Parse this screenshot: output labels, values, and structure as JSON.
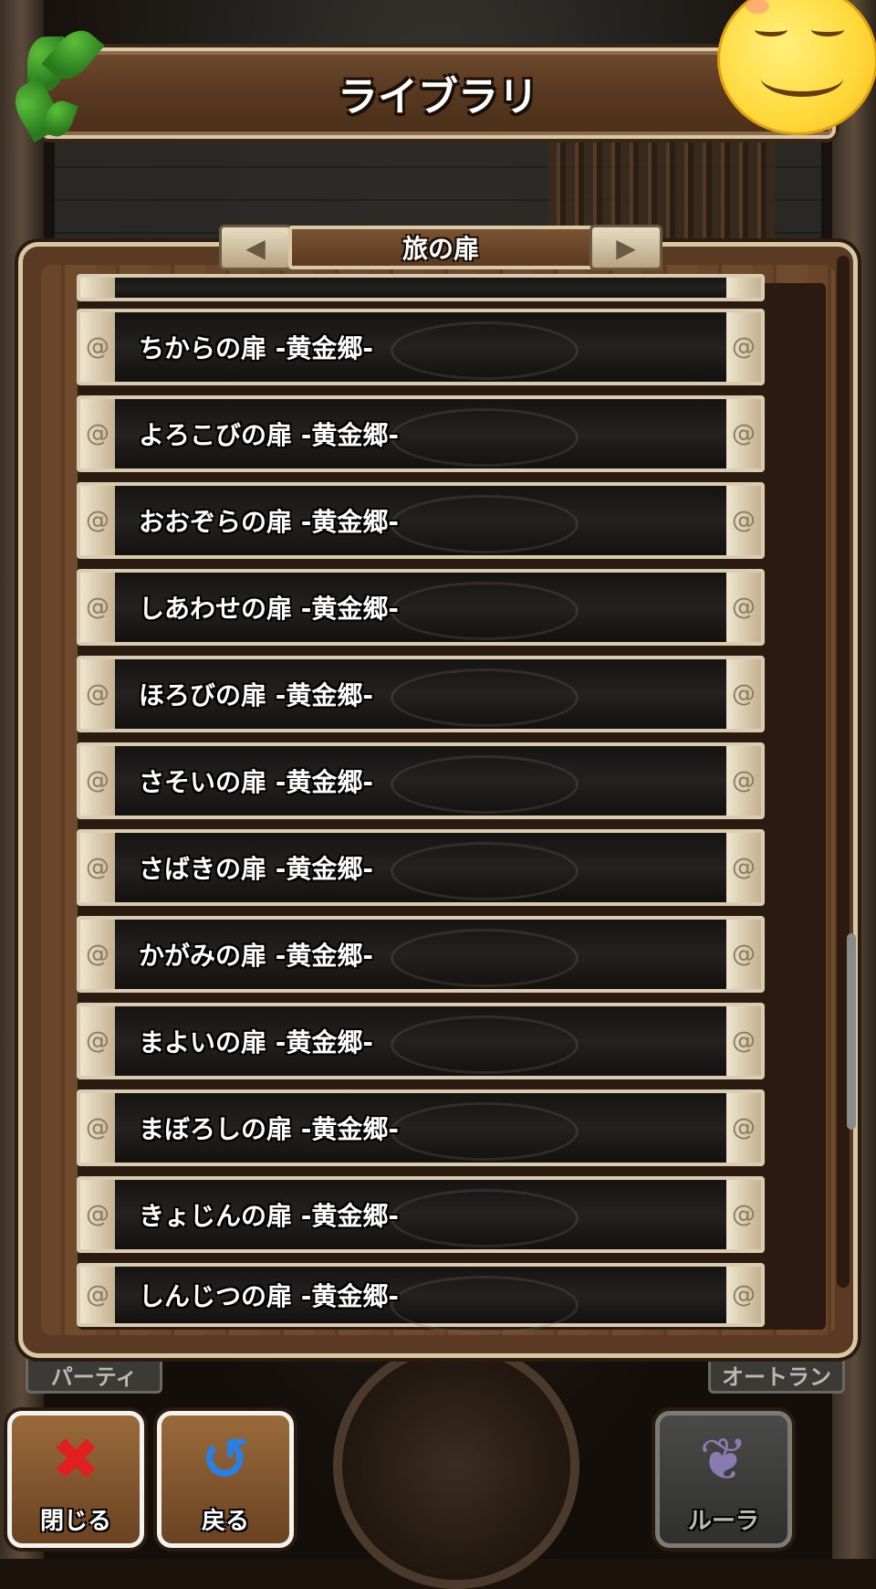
{
  "header": {
    "title": "ライブラリ"
  },
  "section": {
    "title": "旅の扉",
    "prev_icon": "arrow-left-icon",
    "next_icon": "arrow-right-icon"
  },
  "list": {
    "items": [
      "ちからの扉 -黄金郷-",
      "よろこびの扉 -黄金郷-",
      "おおぞらの扉 -黄金郷-",
      "しあわせの扉 -黄金郷-",
      "ほろびの扉 -黄金郷-",
      "さそいの扉 -黄金郷-",
      "さばきの扉 -黄金郷-",
      "かがみの扉 -黄金郷-",
      "まよいの扉 -黄金郷-",
      "まぼろしの扉 -黄金郷-",
      "きょじんの扉 -黄金郷-",
      "しんじつの扉 -黄金郷-"
    ]
  },
  "background_tabs": {
    "party": "パーティ",
    "autorun": "オートラン"
  },
  "footer": {
    "close": {
      "label": "閉じる",
      "icon": "close-x-icon",
      "icon_color": "#e02020"
    },
    "back": {
      "label": "戻る",
      "icon": "back-arrow-icon",
      "icon_color": "#2a7fe0"
    },
    "rula": {
      "label": "ルーラ",
      "icon": "wing-icon",
      "state": "disabled"
    }
  }
}
